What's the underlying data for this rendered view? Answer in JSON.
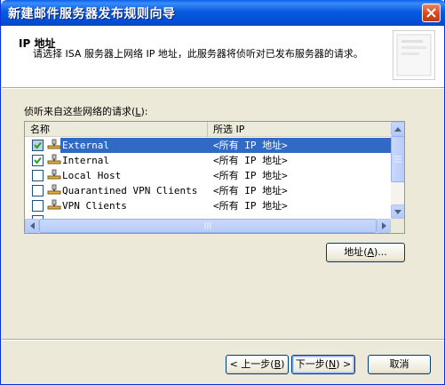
{
  "window": {
    "title": "新建邮件服务器发布规则向导"
  },
  "header": {
    "title": "IP 地址",
    "description": "请选择 ISA 服务器上网络 IP 地址，此服务器将侦听对已发布服务器的请求。"
  },
  "listview": {
    "caption": "侦听来自这些网络的请求",
    "caption_key": "L",
    "columns": [
      "名称",
      "所选 IP"
    ],
    "rows": [
      {
        "name": "External",
        "ip": "<所有 IP 地址>",
        "checked": true,
        "selected": true
      },
      {
        "name": "Internal",
        "ip": "<所有 IP 地址>",
        "checked": true,
        "selected": false
      },
      {
        "name": "Local Host",
        "ip": "<所有 IP 地址>",
        "checked": false,
        "selected": false
      },
      {
        "name": "Quarantined VPN Clients",
        "ip": "<所有 IP 地址>",
        "checked": false,
        "selected": false
      },
      {
        "name": "VPN Clients",
        "ip": "<所有 IP 地址>",
        "checked": false,
        "selected": false
      }
    ]
  },
  "buttons": {
    "address": "地址",
    "address_key": "A",
    "back": "< 上一步",
    "back_key": "B",
    "next": "下一步",
    "next_key": "N",
    "cancel": "取消"
  },
  "colors": {
    "title_bar": "#0a5ae0",
    "selection": "#316ac5",
    "dialog_bg": "#ece9d8"
  }
}
